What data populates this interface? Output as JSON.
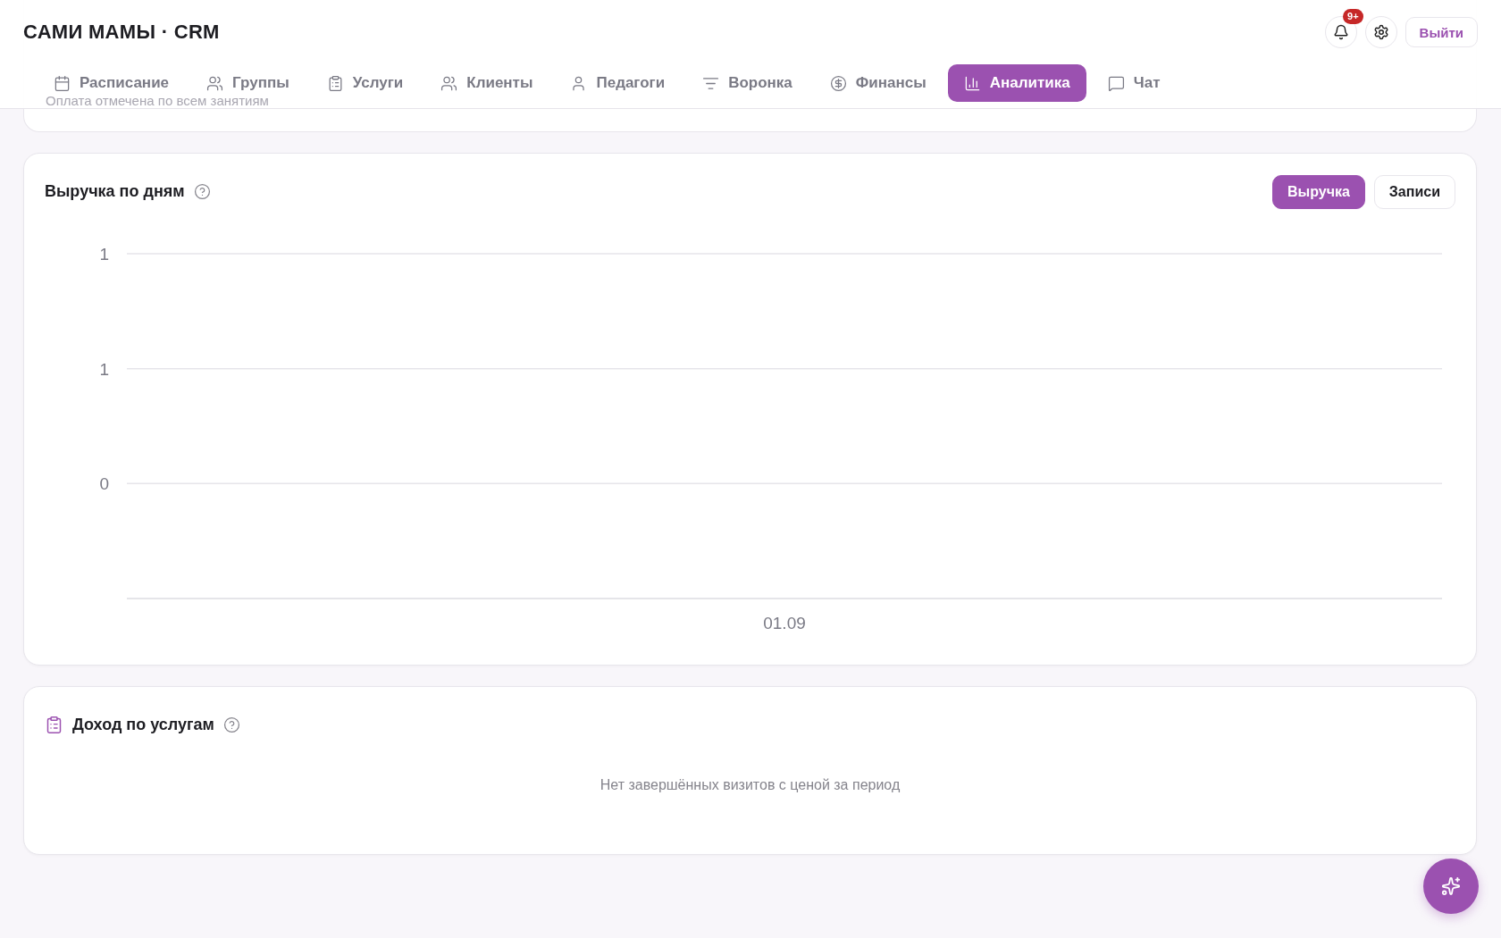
{
  "header": {
    "title": "САМИ МАМЫ · CRM",
    "notifications_badge": "9+",
    "logout_button": "Выйти"
  },
  "tabs": [
    {
      "label": "Расписание",
      "selected": false
    },
    {
      "label": "Группы",
      "selected": false
    },
    {
      "label": "Услуги",
      "selected": false
    },
    {
      "label": "Клиенты",
      "selected": false
    },
    {
      "label": "Педагоги",
      "selected": false
    },
    {
      "label": "Воронка",
      "selected": false
    },
    {
      "label": "Финансы",
      "selected": false
    },
    {
      "label": "Аналитика",
      "selected": true
    },
    {
      "label": "Чат",
      "selected": false
    }
  ],
  "top_card": {
    "note": "Оплата отмечена по всем занятиям"
  },
  "revenue_card": {
    "title": "Выручка по дням",
    "toggles": [
      {
        "label": "Выручка",
        "selected": true
      },
      {
        "label": "Записи",
        "selected": false
      }
    ],
    "chart_data": {
      "type": "bar",
      "categories": [
        "01.09"
      ],
      "series": [
        {
          "values": [
            0
          ]
        }
      ],
      "ylim": [
        -0.5,
        1
      ],
      "yticks": [
        {
          "value": 0,
          "label": "0"
        },
        {
          "value": 0.5,
          "label": "1"
        },
        {
          "value": 1,
          "label": "1"
        }
      ]
    }
  },
  "income_card": {
    "title": "Доход по услугам",
    "empty_message": "Нет завершённых визитов с ценой за период"
  }
}
